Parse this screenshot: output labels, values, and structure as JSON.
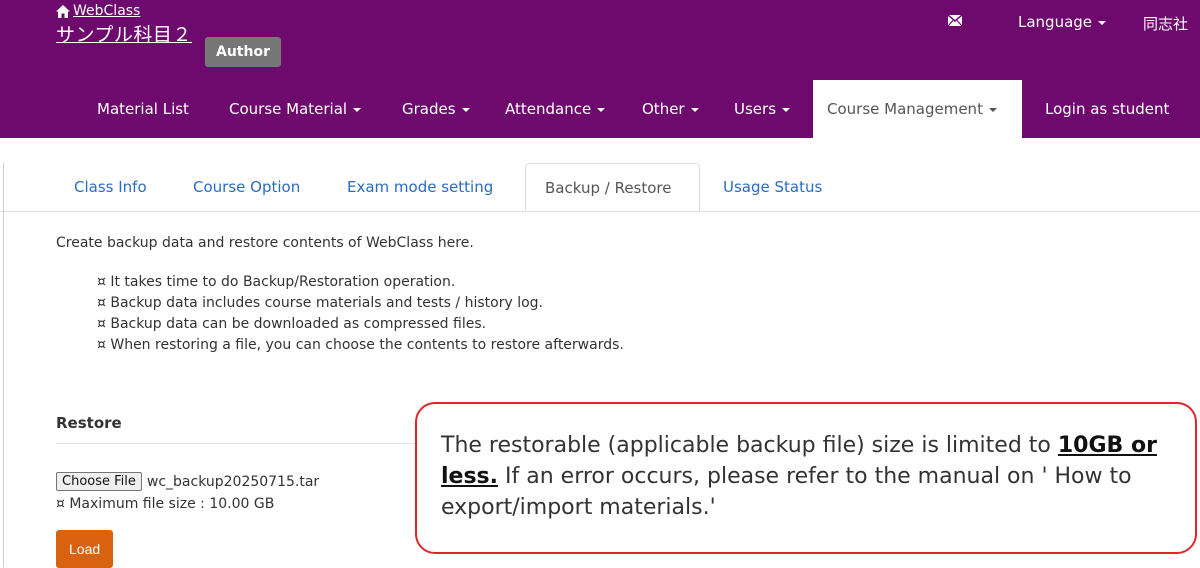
{
  "header": {
    "site_name": "WebClass",
    "course_title": "サンプル科目２",
    "role_badge": "Author",
    "language_label": "Language",
    "school_name": "同志社",
    "colors": {
      "header_bg": "#6e0a6e",
      "accent_orange": "#d9620e",
      "callout_border": "#e3252b"
    },
    "icons": {
      "home": "home-icon",
      "mail": "mail-icon"
    }
  },
  "nav": {
    "material_list": "Material List",
    "course_material": "Course Material",
    "grades": "Grades",
    "attendance": "Attendance",
    "other": "Other",
    "users": "Users",
    "course_management": "Course Management",
    "login_as_student": "Login as student"
  },
  "tabs": {
    "class_info": "Class Info",
    "course_option": "Course Option",
    "exam_mode": "Exam mode setting",
    "backup_restore": "Backup / Restore",
    "usage_status": "Usage Status",
    "active": "backup_restore"
  },
  "content": {
    "intro": "Create backup data and restore contents of WebClass here.",
    "bullets": [
      "¤ It takes time to do Backup/Restoration operation.",
      "¤ Backup data includes course materials and tests / history log.",
      "¤ Backup data can be downloaded as compressed files.",
      "¤ When restoring a file, you can choose the contents to restore afterwards."
    ],
    "restore_heading": "Restore",
    "choose_file_label": "Choose File",
    "file_name": "wc_backup20250715.tar",
    "max_file_size": "¤ Maximum file size : 10.00 GB",
    "load_label": "Load"
  },
  "callout": {
    "text_1": "The restorable (applicable backup file) size is limited to ",
    "highlight": "10GB or less.",
    "text_2": " If an error occurs, please refer to the manual on ' How to export/import materials.'"
  }
}
